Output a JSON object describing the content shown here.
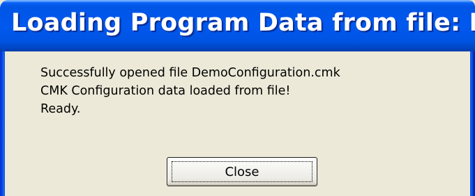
{
  "window": {
    "title": "Loading Program Data from file: De..."
  },
  "messages": [
    "Successfully opened file DemoConfiguration.cmk",
    "CMK Configuration data loaded from file!",
    "Ready."
  ],
  "buttons": {
    "close_label": "Close"
  },
  "colors": {
    "title_bar": "#0054e3",
    "dialog_background": "#ece9d8",
    "title_text": "#ffffff"
  }
}
